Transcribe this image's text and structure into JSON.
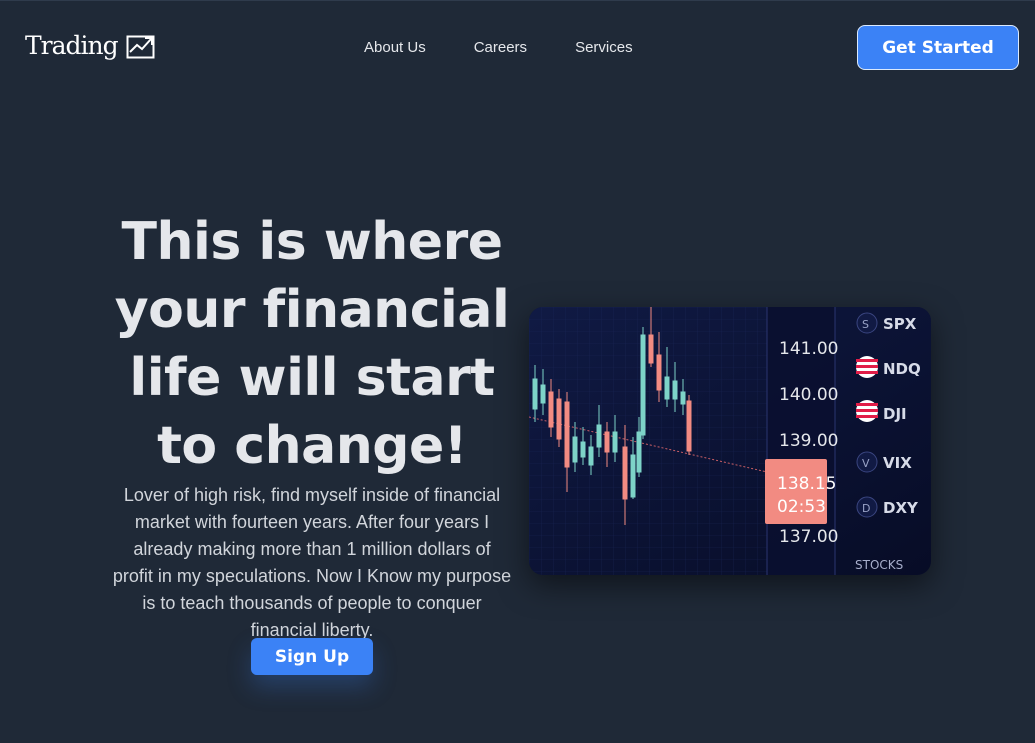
{
  "navbar": {
    "logo_text": "Trading",
    "links": [
      {
        "label": "About Us"
      },
      {
        "label": "Careers"
      },
      {
        "label": "Services"
      }
    ],
    "cta_label": "Get Started"
  },
  "hero": {
    "headline": "This is where your financial life will start to change!",
    "description": "Lover of high risk, find myself inside of financial market with fourteen years. After four years I already making more than 1 million dollars of profit in my speculations. Now I Know my purpose is to teach thousands of people to conquer financial liberty.",
    "signup_label": "Sign Up"
  },
  "hero_image": {
    "price_labels": [
      "141.00",
      "140.00",
      "139.00",
      "137.00"
    ],
    "current_price": "138.15",
    "current_time": "02:53",
    "tickers": [
      "SPX",
      "NDQ",
      "DJI",
      "VIX",
      "DXY"
    ],
    "footer_label": "STOCKS"
  },
  "colors": {
    "background": "#1f2937",
    "accent": "#3b82f6",
    "text": "#e5e7eb"
  },
  "icons": {
    "logo": "trend-chart-icon"
  }
}
